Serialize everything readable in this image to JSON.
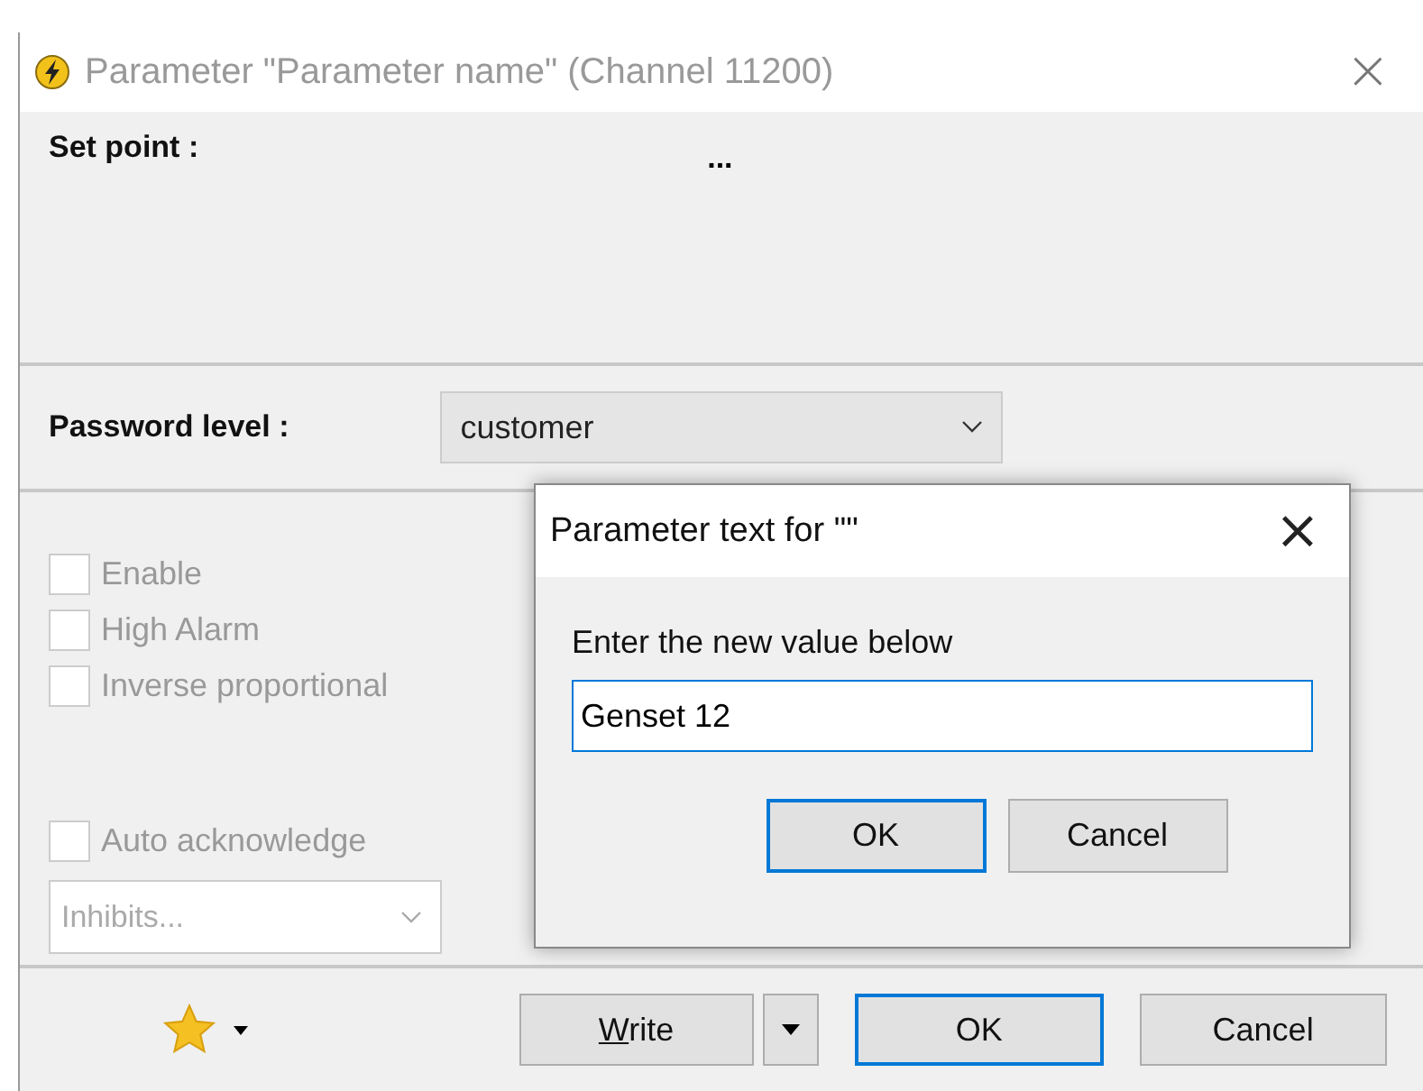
{
  "window": {
    "title": "Parameter \"Parameter name\" (Channel 11200)",
    "close": "×"
  },
  "set_point": {
    "label": "Set point :",
    "value": "..."
  },
  "password_level": {
    "label": "Password level :",
    "value": "customer"
  },
  "options": [
    {
      "label": "Enable",
      "checked": false,
      "disabled": true
    },
    {
      "label": "High Alarm",
      "checked": false,
      "disabled": true
    },
    {
      "label": "Inverse proportional",
      "checked": false,
      "disabled": true
    }
  ],
  "auto_acknowledge": {
    "label": "Auto acknowledge",
    "checked": false,
    "disabled": true
  },
  "inhibits": {
    "value": "Inhibits...",
    "disabled": true
  },
  "footer": {
    "buttons": [
      {
        "kind": "split",
        "label": "Write",
        "mnemonic": true,
        "default": false
      },
      {
        "kind": "plain",
        "label": "OK",
        "default": true
      },
      {
        "kind": "plain",
        "label": "Cancel",
        "default": false
      }
    ]
  },
  "dialog": {
    "title": "Parameter text for \"\"",
    "close": "×",
    "prompt": "Enter the new value below",
    "value": "Genset 12",
    "buttons": [
      {
        "label": "OK",
        "default": true
      },
      {
        "label": "Cancel",
        "default": false
      }
    ]
  }
}
